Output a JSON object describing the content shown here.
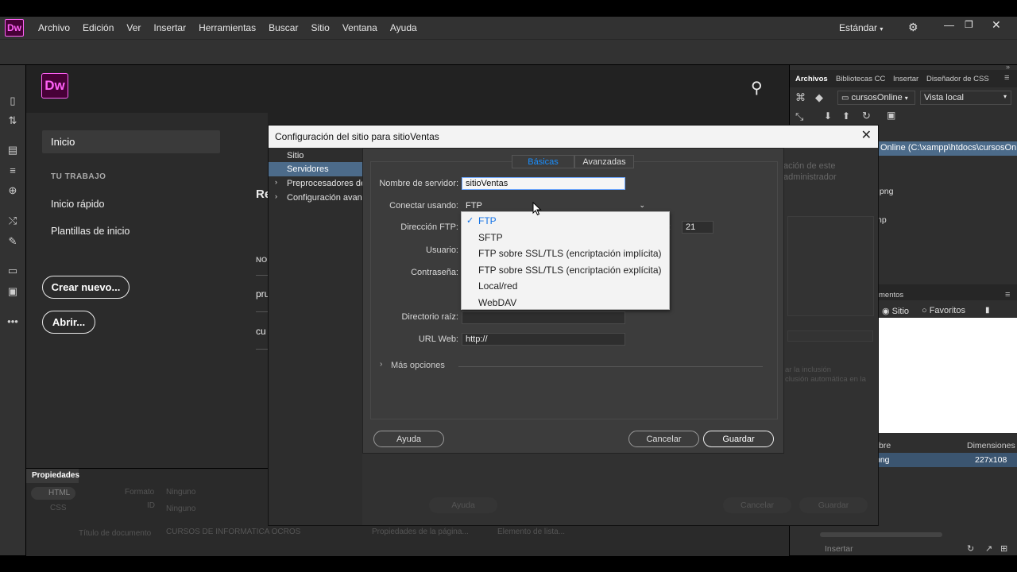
{
  "menubar": {
    "logo": "Dw",
    "items": [
      "Archivo",
      "Edición",
      "Ver",
      "Insertar",
      "Herramientas",
      "Buscar",
      "Sitio",
      "Ventana",
      "Ayuda"
    ],
    "workspace": "Estándar"
  },
  "home": {
    "logo": "Dw",
    "nav_inicio": "Inicio",
    "section_title": "TU TRABAJO",
    "quick_start": "Inicio rápido",
    "templates": "Plantillas de inicio",
    "create_new": "Crear nuevo...",
    "open": "Abrir...",
    "recent_partial": "Re",
    "col_partial": "NO",
    "row1_partial": "pru",
    "row2_partial": "cu"
  },
  "properties": {
    "tab": "Propiedades",
    "html": "HTML",
    "css": "CSS",
    "format_label": "Formato",
    "format_value": "Ninguno",
    "id_label": "ID",
    "id_value": "Ninguno",
    "doc_title_label": "Título de documento",
    "doc_title_value": "CURSOS DE INFORMATICA OCROS",
    "page_props": "Propiedades de la página...",
    "list_elem": "Elemento de lista..."
  },
  "rpanel": {
    "tabs": [
      "Archivos",
      "Bibliotecas CC",
      "Insertar",
      "Diseñador de CSS"
    ],
    "site_select": "cursosOnline",
    "view_select": "Vista local",
    "site_path": "Online (C:\\xampp\\htdocs\\cursosOn...",
    "file1": ".png",
    "file2": "np",
    "assets_label": "mentos",
    "radio_site": "Sitio",
    "radio_fav": "Favoritos",
    "col_name": "bre",
    "col_dims": "Dimensiones",
    "row_name": "png",
    "row_dims": "227x108",
    "bg_text1": "ación de este",
    "bg_text2": "administrador",
    "bg_text3": "ar la inclusión",
    "bg_text4": "clusión automática en la",
    "insert_btn": "Insertar"
  },
  "dialog": {
    "title": "Configuración del sitio para sitioVentas",
    "nav": [
      "Sitio",
      "Servidores",
      "Preprocesadores de",
      "Configuración avanz"
    ],
    "tab_basic": "Básicas",
    "tab_advanced": "Avanzadas",
    "server_name_label": "Nombre de servidor:",
    "server_name_value": "sitioVentas",
    "connect_label": "Conectar usando:",
    "connect_value": "FTP",
    "ftp_address_label": "Dirección FTP:",
    "port_label": "o:",
    "port_value": "21",
    "user_label": "Usuario:",
    "password_label": "Contraseña:",
    "root_label": "Directorio raíz:",
    "url_label": "URL Web:",
    "url_value": "http://",
    "more_options": "Más opciones",
    "help": "Ayuda",
    "cancel": "Cancelar",
    "save": "Guardar",
    "bg_help": "Ayuda",
    "bg_cancel": "Cancelar",
    "bg_save": "Guardar"
  },
  "popup": {
    "options": [
      "FTP",
      "SFTP",
      "FTP sobre SSL/TLS (encriptación implícita)",
      "FTP sobre SSL/TLS (encriptación explícita)",
      "Local/red",
      "WebDAV"
    ],
    "selected": "FTP"
  }
}
